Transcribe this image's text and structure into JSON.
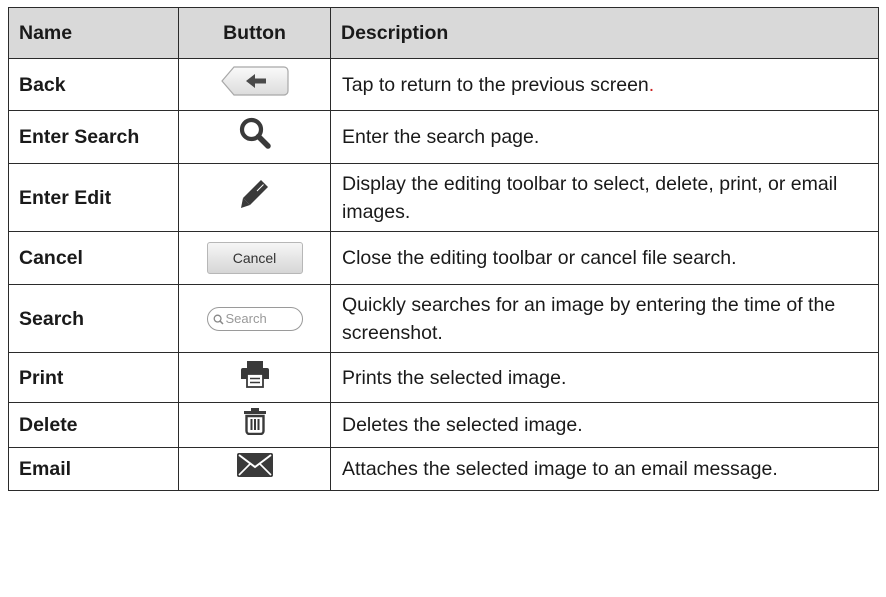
{
  "headers": {
    "name": "Name",
    "button": "Button",
    "description": "Description"
  },
  "rows": [
    {
      "name": "Back",
      "icon": "back-arrow-icon",
      "description": "Tap to return to the previous screen",
      "trailing": "."
    },
    {
      "name": "Enter Search",
      "icon": "magnifier-icon",
      "description": "Enter the search page."
    },
    {
      "name": "Enter Edit",
      "icon": "pencil-icon",
      "description": "Display the editing toolbar to select, delete, print, or email images."
    },
    {
      "name": "Cancel",
      "icon": "cancel-button",
      "button_label": "Cancel",
      "description": "Close the editing toolbar or cancel file search."
    },
    {
      "name": "Search",
      "icon": "search-field",
      "button_label": "Search",
      "description": "Quickly searches for an image by entering the time of the screenshot."
    },
    {
      "name": "Print",
      "icon": "printer-icon",
      "description": "Prints the selected image."
    },
    {
      "name": "Delete",
      "icon": "trash-icon",
      "description": "Deletes the selected image."
    },
    {
      "name": "Email",
      "icon": "envelope-icon",
      "description": "Attaches the selected image to an email message."
    }
  ],
  "colors": {
    "header_bg": "#d9d9d9",
    "border": "#2b2b2b",
    "accent_red": "#cc2222"
  }
}
